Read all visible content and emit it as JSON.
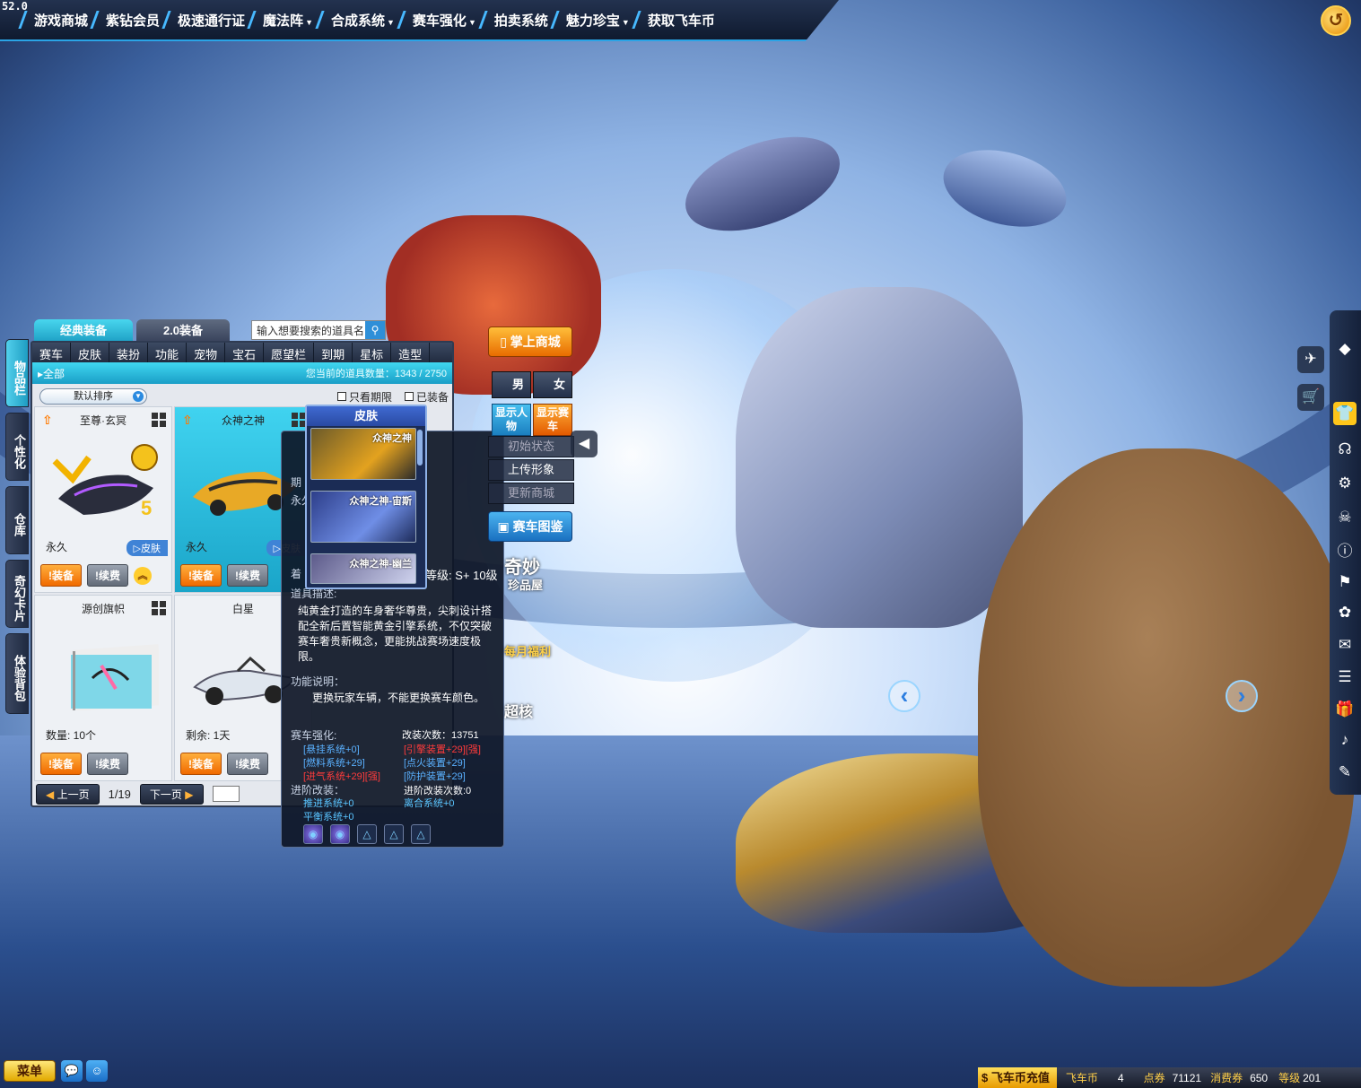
{
  "fps": "52.0",
  "topnav": [
    {
      "label": "游戏商城",
      "dropdown": false
    },
    {
      "label": "紫钻会员",
      "dropdown": false
    },
    {
      "label": "极速通行证",
      "dropdown": false
    },
    {
      "label": "魔法阵",
      "dropdown": true
    },
    {
      "label": "合成系统",
      "dropdown": true
    },
    {
      "label": "赛车强化",
      "dropdown": true
    },
    {
      "label": "拍卖系统",
      "dropdown": false
    },
    {
      "label": "魅力珍宝",
      "dropdown": true
    },
    {
      "label": "获取飞车币",
      "dropdown": false
    }
  ],
  "inventory": {
    "tabs": [
      "经典装备",
      "2.0装备"
    ],
    "search_placeholder": "输入想要搜索的道具名",
    "side_tabs": [
      "物品栏",
      "个性化",
      "仓库",
      "奇幻卡片",
      "体验背包"
    ],
    "categories": [
      "赛车",
      "皮肤",
      "装扮",
      "功能",
      "宠物",
      "宝石",
      "愿望栏",
      "到期",
      "星标",
      "造型"
    ],
    "all_label": "全部",
    "count_text": "您当前的道具数量：1343 / 2750",
    "sort_label": "默认排序",
    "filters": [
      "只看期限",
      "已装备"
    ],
    "items": [
      {
        "name": "至尊·玄冥",
        "duration": "永久",
        "skin_badge": "皮肤",
        "equip": "装备",
        "renew": "续费",
        "selected": false
      },
      {
        "name": "众神之神",
        "duration": "永久",
        "skin_badge": "皮肤",
        "equip": "装备",
        "renew": "续费",
        "selected": true
      },
      {
        "name": "源创旗帜",
        "duration": "数量: 10个",
        "equip": "装备",
        "renew": "续费",
        "selected": false
      },
      {
        "name": "白星",
        "duration": "剩余: 1天",
        "equip": "装备",
        "renew": "续费",
        "selected": false
      }
    ],
    "pager": {
      "prev": "上一页",
      "page": "1/19",
      "next": "下一页"
    }
  },
  "skin_popup": {
    "title": "皮肤",
    "items": [
      "众神之神",
      "众神之神-宙斯",
      "众神之神-幽兰"
    ]
  },
  "tooltip": {
    "labels": {
      "period": "期",
      "perm": "永久",
      "equip_label": "着",
      "level": "等级: S+ 10级"
    },
    "desc_title": "道具描述:",
    "description": "纯黄金打造的车身奢华尊贵，尖刺设计搭配全新后置智能黄金引擎系统，不仅突破赛车奢贵新概念，更能挑战赛场速度极限。",
    "func_title": "功能说明：",
    "func_text": "更换玩家车辆，不能更换赛车颜色。",
    "strength_title": "赛车强化:",
    "mod_count": "改装次数：13751",
    "strength": [
      {
        "text": "[悬挂系统+0]",
        "tone": "blue"
      },
      {
        "text": "[引擎装置+29][强]",
        "tone": "red"
      },
      {
        "text": "[燃料系统+29]",
        "tone": "blue"
      },
      {
        "text": "[点火装置+29]",
        "tone": "blue"
      },
      {
        "text": "[进气系统+29][强]",
        "tone": "red"
      },
      {
        "text": "[防护装置+29]",
        "tone": "blue"
      }
    ],
    "adv_title": "进阶改装：",
    "adv_count": "进阶改装次数:0",
    "adv": [
      "推进系统+0",
      "离合系统+0",
      "平衡系统+0"
    ]
  },
  "mid_panel": {
    "shop_btn": "掌上商城",
    "male": "男",
    "female": "女",
    "show_char": "显示人物",
    "show_car": "显示赛车",
    "reset": "初始状态",
    "upload": "上传形象",
    "update": "更新商城",
    "atlas": "赛车图鉴"
  },
  "promos": {
    "qimiao": "奇妙",
    "zhenpin": "珍品屋",
    "welfare": "每月福利",
    "chao": "超核"
  },
  "right_icons": [
    "diamond-icon",
    "wings-icon",
    "cart-icon",
    "shirt-icon",
    "headset-icon",
    "gear-icon",
    "skull-icon",
    "info-icon",
    "flag-icon",
    "paw-icon",
    "mail-icon",
    "notes-icon",
    "gift-icon",
    "music-icon",
    "chat-icon"
  ],
  "bottom": {
    "menu": "菜单",
    "recharge": "飞车币充值",
    "coin_label": "飞车币",
    "coin": "4",
    "points_label": "点券",
    "points": "71121",
    "voucher_label": "消费券",
    "voucher": "650",
    "level_label": "等级",
    "level": "201"
  },
  "colors": {
    "accent": "#2aa4e6",
    "orange": "#f06a00",
    "panel": "#e5e8ee"
  }
}
